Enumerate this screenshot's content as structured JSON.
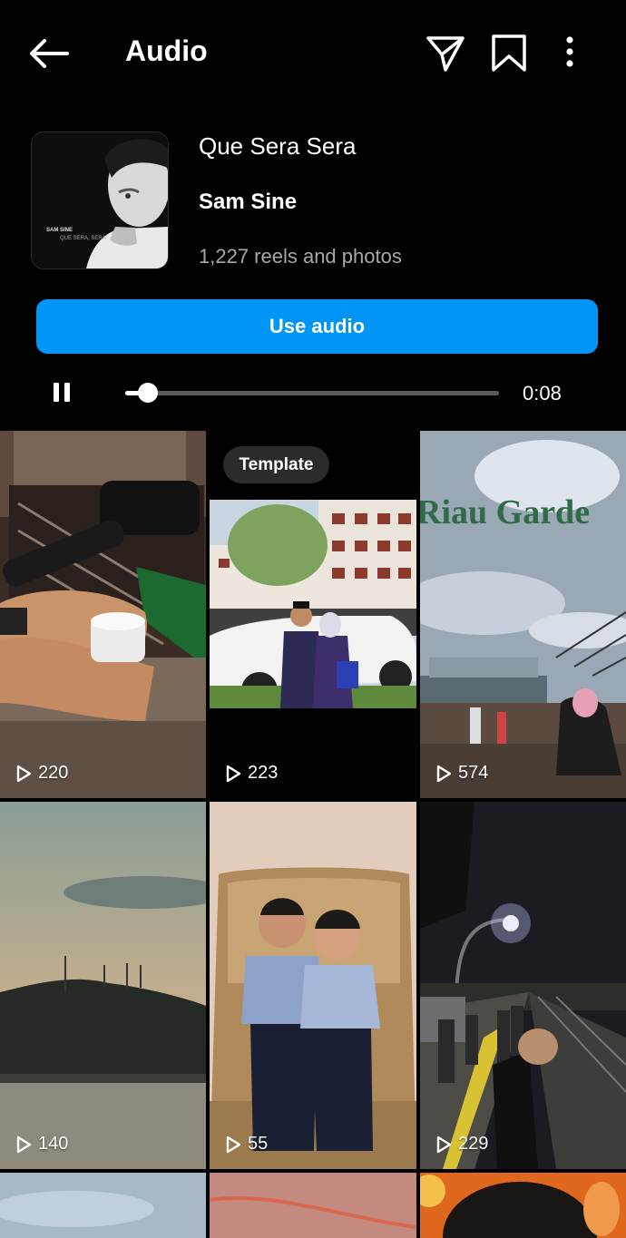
{
  "header": {
    "title": "Audio",
    "back_icon": "arrow-left-icon",
    "icons": [
      "send-icon",
      "bookmark-icon",
      "more-vertical-icon"
    ]
  },
  "audio": {
    "song_title": "Que Sera Sera",
    "artist": "Sam Sine",
    "count": "1,227 reels and photos",
    "album_line1": "SAM SINE",
    "album_line2": "QUE SERA, SERA",
    "use_button": "Use audio",
    "time": "0:08",
    "progress_fraction": 0.06
  },
  "grid": {
    "template_label": "Template",
    "tiles": [
      {
        "views": "220"
      },
      {
        "views": "223"
      },
      {
        "views": "574"
      },
      {
        "views": "140"
      },
      {
        "views": "55"
      },
      {
        "views": "229"
      }
    ]
  },
  "colors": {
    "accent": "#0095f6",
    "background": "#000000",
    "muted_text": "#a8a8a8"
  }
}
